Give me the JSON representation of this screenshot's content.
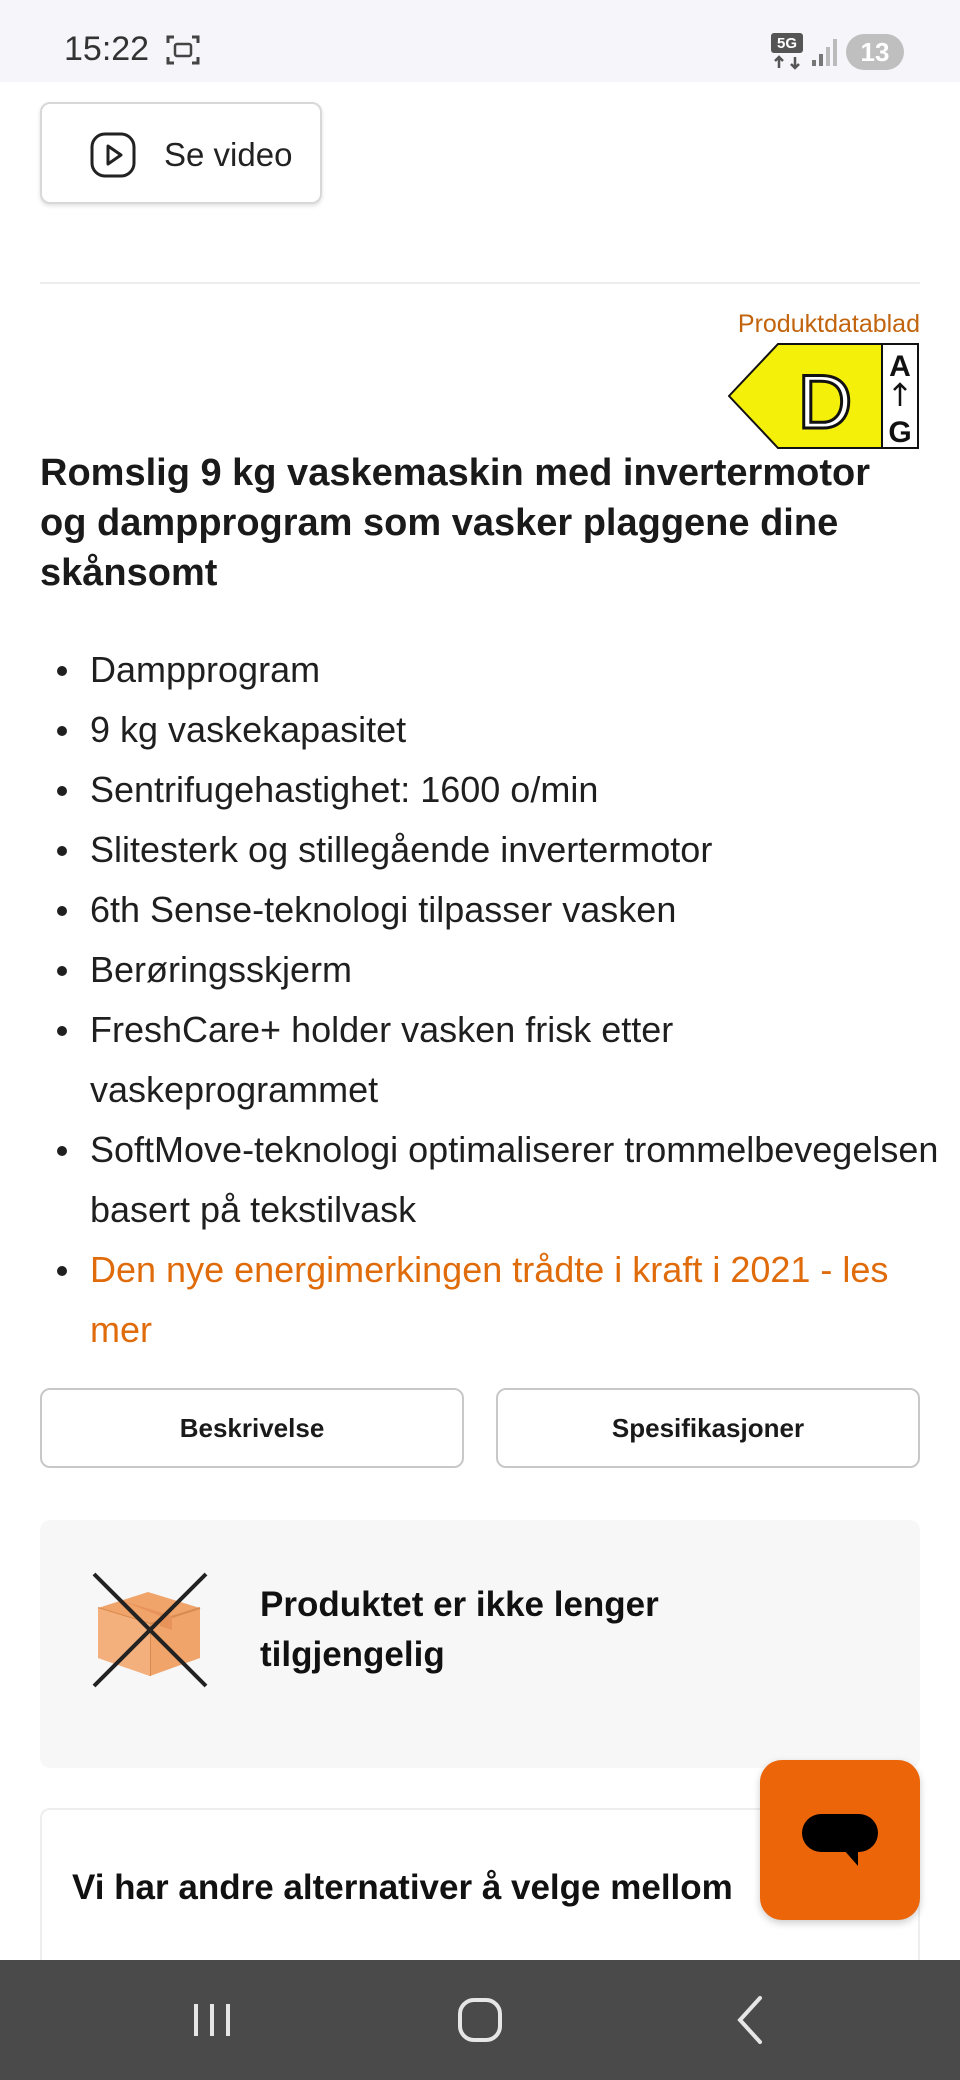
{
  "status_bar": {
    "time": "15:22",
    "network": "5G",
    "notification_count": "13"
  },
  "video_button": {
    "label": "Se video",
    "icon": "play-icon"
  },
  "energy": {
    "datasheet_label": "Produktdatablad",
    "class": "D",
    "scale_top": "A",
    "scale_bottom": "G",
    "color": "#f5f00a"
  },
  "product": {
    "title": "Romslig 9 kg vaskemaskin med invertermotor og dampprogram som vasker plaggene dine skånsomt",
    "features": [
      "Dampprogram",
      "9 kg vaskekapasitet",
      "Sentrifugehastighet: 1600 o/min",
      "Slitesterk og stillegående invertermotor",
      "6th Sense-teknologi tilpasser vasken",
      "Berøringsskjerm",
      "FreshCare+ holder vasken frisk etter vaskeprogrammet",
      "SoftMove-teknologi optimaliserer trommelbevegelsen basert på tekstilvask"
    ],
    "energy_link": "Den nye energimerkingen trådte i kraft i 2021 - les mer"
  },
  "tabs": {
    "description": "Beskrivelse",
    "specifications": "Spesifikasjoner"
  },
  "availability": {
    "message": "Produktet er ikke lenger tilgjengelig"
  },
  "alternatives": {
    "title": "Vi har andre alternativer å velge mellom"
  },
  "colors": {
    "accent": "#ec6609",
    "link": "#e06b0b"
  }
}
